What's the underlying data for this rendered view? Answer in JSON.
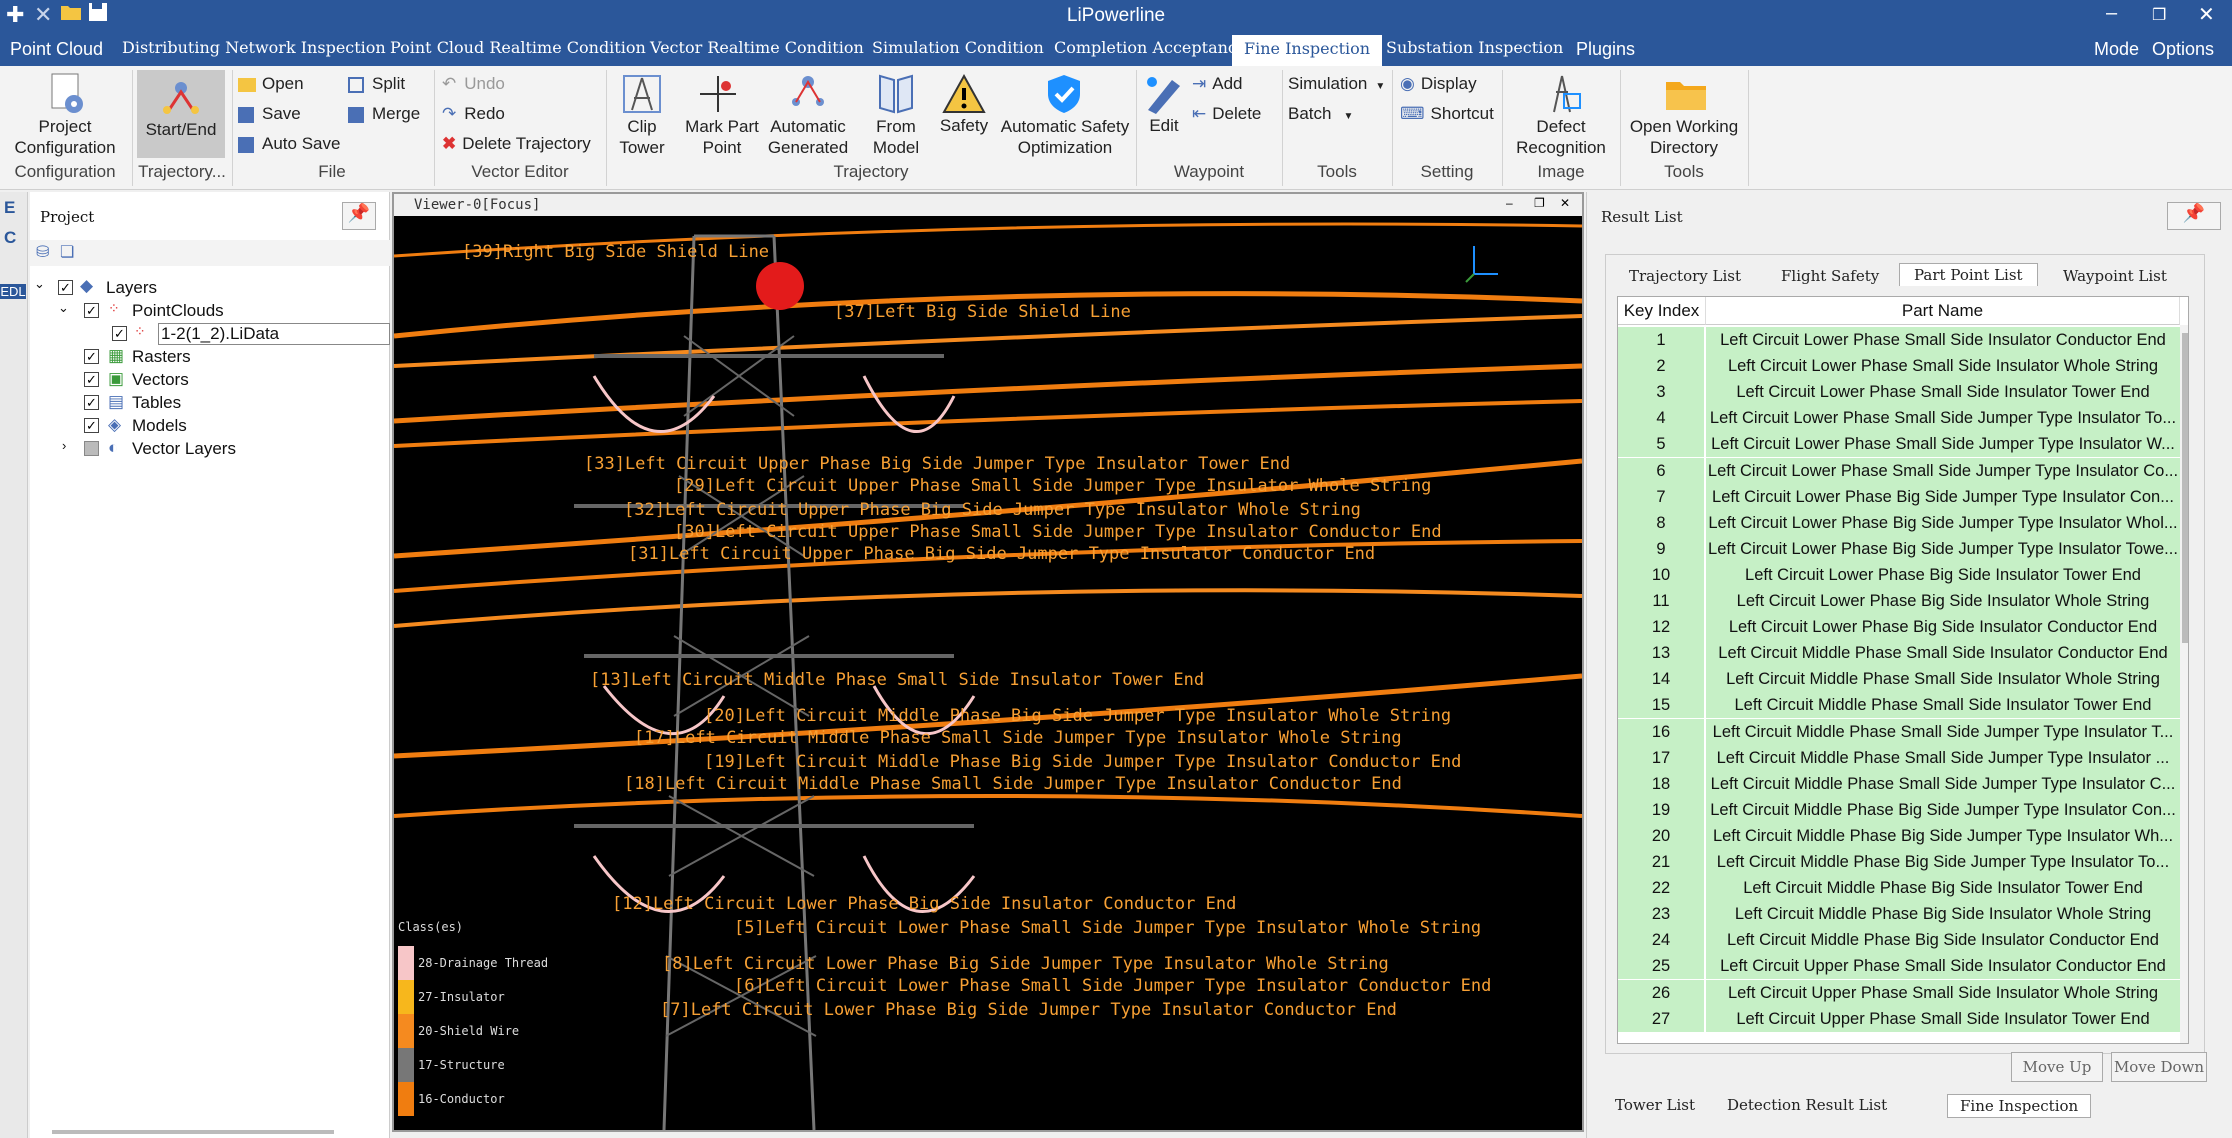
{
  "window": {
    "title": "LiPowerline"
  },
  "menu": {
    "tabs": [
      "Point Cloud",
      "Distributing Network Inspection",
      "Point Cloud Realtime Condition",
      "Vector Realtime Condition",
      "Simulation Condition",
      "Completion Acceptance",
      "Fine Inspection",
      "Substation Inspection",
      "Plugins"
    ],
    "active": "Fine Inspection",
    "right": [
      "Mode",
      "Options"
    ]
  },
  "ribbon": {
    "project_configuration": "Project\nConfiguration",
    "start_end": "Start/End",
    "open": "Open",
    "save": "Save",
    "auto_save": "Auto Save",
    "split": "Split",
    "merge": "Merge",
    "undo": "Undo",
    "redo": "Redo",
    "delete_trajectory": "Delete Trajectory",
    "clip_tower": "Clip\nTower",
    "mark_part_point": "Mark Part\nPoint",
    "automatic_generated": "Automatic\nGenerated",
    "from_model": "From\nModel",
    "safety": "Safety",
    "auto_safety_opt": "Automatic Safety\nOptimization",
    "edit": "Edit",
    "add": "Add",
    "delete": "Delete",
    "simulation": "Simulation",
    "batch": "Batch",
    "display": "Display",
    "shortcut": "Shortcut",
    "defect_recognition": "Defect\nRecognition",
    "open_working_directory": "Open Working\nDirectory",
    "groups": {
      "configuration": "Configuration",
      "trajectory_ellipsis": "Trajectory...",
      "file": "File",
      "vector_editor": "Vector Editor",
      "trajectory": "Trajectory",
      "waypoint": "Waypoint",
      "tools": "Tools",
      "setting": "Setting",
      "image": "Image",
      "tools2": "Tools"
    }
  },
  "project": {
    "title": "Project",
    "tree": [
      "Layers",
      "PointClouds",
      "1-2(1_2).LiData",
      "Rasters",
      "Vectors",
      "Tables",
      "Models",
      "Vector Layers"
    ],
    "side_letters": [
      "E",
      "C",
      "EDL"
    ]
  },
  "viewer": {
    "title": "Viewer-0[Focus]",
    "labels": [
      "[39]Right Big Side Shield Line",
      "[37]Left Big Side Shield Line",
      "[33]Left Circuit Upper Phase Big Side Jumper Type Insulator Tower End",
      "[29]Left Circuit Upper Phase Small Side Jumper Type Insulator Whole String",
      "[32]Left Circuit Upper Phase Big Side Jumper Type Insulator Whole String",
      "[30]Left Circuit Upper Phase Small Side Jumper Type Insulator Conductor End",
      "[31]Left Circuit Upper Phase Big Side Jumper Type Insulator Conductor End",
      "[13]Left Circuit Middle Phase Small Side Insulator Tower End",
      "[20]Left Circuit Middle Phase Big Side Jumper Type Insulator Whole String",
      "[17]Left Circuit Middle Phase Small Side Jumper Type Insulator Whole String",
      "[19]Left Circuit Middle Phase Big Side Jumper Type Insulator Conductor End",
      "[18]Left Circuit Middle Phase Small Side Jumper Type Insulator Conductor End",
      "[12]Left Circuit Lower Phase Big Side Insulator Conductor End",
      "[5]Left Circuit Lower Phase Small Side Jumper Type Insulator Whole String",
      "[8]Left Circuit Lower Phase Big Side Jumper Type Insulator Whole String",
      "[6]Left Circuit Lower Phase Small Side Jumper Type Insulator Conductor End",
      "[7]Left Circuit Lower Phase Big Side Jumper Type Insulator Conductor End"
    ],
    "legend_title": "Class(es)",
    "legend": [
      {
        "name": "28-Drainage Thread",
        "color": "#f7c6c8"
      },
      {
        "name": "27-Insulator",
        "color": "#f7b71c"
      },
      {
        "name": "20-Shield Wire",
        "color": "#f58a1f"
      },
      {
        "name": "17-Structure",
        "color": "#777777"
      },
      {
        "name": "16-Conductor",
        "color": "#f07d10"
      }
    ]
  },
  "result": {
    "title": "Result List",
    "tabs": [
      "Trajectory List",
      "Flight Safety",
      "Part Point List",
      "Waypoint List"
    ],
    "active_tab": "Part Point List",
    "columns": [
      "Key Index",
      "Part Name"
    ],
    "rows": [
      [
        "1",
        "Left Circuit Lower Phase Small Side Insulator Conductor End"
      ],
      [
        "2",
        "Left Circuit Lower Phase Small Side Insulator Whole String"
      ],
      [
        "3",
        "Left Circuit Lower Phase Small Side Insulator Tower End"
      ],
      [
        "4",
        "Left Circuit Lower Phase Small Side Jumper Type Insulator To..."
      ],
      [
        "5",
        "Left Circuit Lower Phase Small Side Jumper Type Insulator W..."
      ],
      [
        "6",
        "Left Circuit Lower Phase Small Side Jumper Type Insulator Co..."
      ],
      [
        "7",
        "Left Circuit Lower Phase Big Side Jumper Type Insulator Con..."
      ],
      [
        "8",
        "Left Circuit Lower Phase Big Side Jumper Type Insulator Whol..."
      ],
      [
        "9",
        "Left Circuit Lower Phase Big Side Jumper Type Insulator Towe..."
      ],
      [
        "10",
        "Left Circuit Lower Phase Big Side Insulator Tower End"
      ],
      [
        "11",
        "Left Circuit Lower Phase Big Side Insulator Whole String"
      ],
      [
        "12",
        "Left Circuit Lower Phase Big Side Insulator Conductor End"
      ],
      [
        "13",
        "Left Circuit Middle Phase Small Side Insulator Conductor End"
      ],
      [
        "14",
        "Left Circuit Middle Phase Small Side Insulator Whole String"
      ],
      [
        "15",
        "Left Circuit Middle Phase Small Side Insulator Tower End"
      ],
      [
        "16",
        "Left Circuit Middle Phase Small Side Jumper Type Insulator T..."
      ],
      [
        "17",
        "Left Circuit Middle Phase Small Side Jumper Type Insulator ..."
      ],
      [
        "18",
        "Left Circuit Middle Phase Small Side Jumper Type Insulator C..."
      ],
      [
        "19",
        "Left Circuit Middle Phase Big Side Jumper Type Insulator Con..."
      ],
      [
        "20",
        "Left Circuit Middle Phase Big Side Jumper Type Insulator Wh..."
      ],
      [
        "21",
        "Left Circuit Middle Phase Big Side Jumper Type Insulator To..."
      ],
      [
        "22",
        "Left Circuit Middle Phase Big Side Insulator Tower End"
      ],
      [
        "23",
        "Left Circuit Middle Phase Big Side Insulator Whole String"
      ],
      [
        "24",
        "Left Circuit Middle Phase Big Side Insulator Conductor End"
      ],
      [
        "25",
        "Left Circuit Upper Phase Small Side Insulator Conductor End"
      ],
      [
        "26",
        "Left Circuit Upper Phase Small Side Insulator Whole String"
      ],
      [
        "27",
        "Left Circuit Upper Phase Small Side Insulator Tower End"
      ]
    ],
    "move_up": "Move Up",
    "move_down": "Move Down",
    "bottom_tabs": [
      "Tower List",
      "Detection Result List",
      "Fine Inspection"
    ],
    "active_bottom": "Fine Inspection"
  }
}
